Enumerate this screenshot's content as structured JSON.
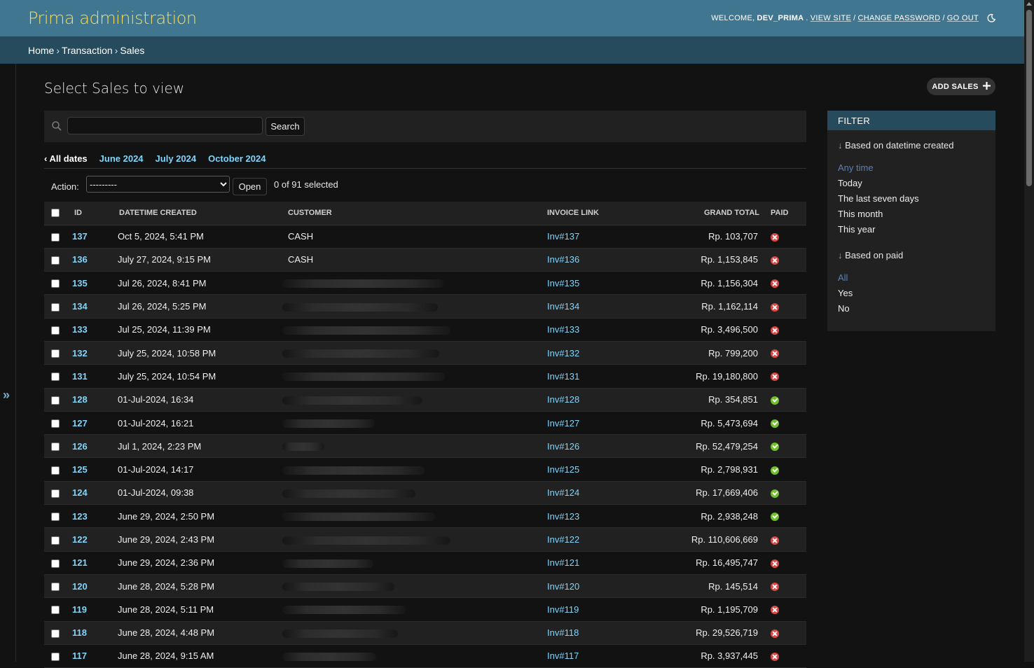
{
  "header": {
    "site_name": "Prima administration",
    "welcome_prefix": "Welcome,",
    "username": "dev_prima",
    "view_site": "View site",
    "change_password": "Change password",
    "log_out": "Go out"
  },
  "breadcrumbs": [
    "Home",
    "Transaction",
    "Sales"
  ],
  "page_title": "Select Sales to view",
  "add_button": "Add Sales",
  "search": {
    "button": "Search",
    "value": ""
  },
  "date_hierarchy": {
    "all": "All dates",
    "links": [
      "June 2024",
      "July 2024",
      "October 2024"
    ]
  },
  "actions": {
    "label": "Action:",
    "selected": "---------",
    "go": "Open",
    "counter": "0 of 91 selected"
  },
  "table": {
    "columns": [
      "ID",
      "Datetime created",
      "Customer",
      "Invoice link",
      "Grand total",
      "Paid"
    ],
    "rows": [
      {
        "id": "137",
        "dt": "Oct 5, 2024, 5:41 PM",
        "customer": "CASH",
        "invoice": "Inv#137",
        "total": "Rp. 103,707",
        "paid": false
      },
      {
        "id": "136",
        "dt": "July 27, 2024, 9:15 PM",
        "customer": "CASH",
        "invoice": "Inv#136",
        "total": "Rp. 1,153,845",
        "paid": false
      },
      {
        "id": "135",
        "dt": "Jul 26, 2024, 8:41 PM",
        "customer": "",
        "invoice": "Inv#135",
        "total": "Rp. 1,156,304",
        "paid": false
      },
      {
        "id": "134",
        "dt": "Jul 26, 2024, 5:25 PM",
        "customer": "",
        "invoice": "Inv#134",
        "total": "Rp. 1,162,114",
        "paid": false
      },
      {
        "id": "133",
        "dt": "Jul 25, 2024, 11:39 PM",
        "customer": "",
        "invoice": "Inv#133",
        "total": "Rp. 3,496,500",
        "paid": false
      },
      {
        "id": "132",
        "dt": "July 25, 2024, 10:58 PM",
        "customer": "",
        "invoice": "Inv#132",
        "total": "Rp. 799,200",
        "paid": false
      },
      {
        "id": "131",
        "dt": "July 25, 2024, 10:54 PM",
        "customer": "",
        "invoice": "Inv#131",
        "total": "Rp. 19,180,800",
        "paid": false
      },
      {
        "id": "128",
        "dt": "01-Jul-2024, 16:34",
        "customer": "",
        "invoice": "Inv#128",
        "total": "Rp. 354,851",
        "paid": true
      },
      {
        "id": "127",
        "dt": "01-Jul-2024, 16:21",
        "customer": "",
        "invoice": "Inv#127",
        "total": "Rp. 5,473,694",
        "paid": true
      },
      {
        "id": "126",
        "dt": "Jul 1, 2024, 2:23 PM",
        "customer": "",
        "invoice": "Inv#126",
        "total": "Rp. 52,479,254",
        "paid": true
      },
      {
        "id": "125",
        "dt": "01-Jul-2024, 14:17",
        "customer": "",
        "invoice": "Inv#125",
        "total": "Rp. 2,798,931",
        "paid": true
      },
      {
        "id": "124",
        "dt": "01-Jul-2024, 09:38",
        "customer": "",
        "invoice": "Inv#124",
        "total": "Rp. 17,669,406",
        "paid": true
      },
      {
        "id": "123",
        "dt": "June 29, 2024, 2:50 PM",
        "customer": "",
        "invoice": "Inv#123",
        "total": "Rp. 2,938,248",
        "paid": true
      },
      {
        "id": "122",
        "dt": "June 29, 2024, 2:43 PM",
        "customer": "",
        "invoice": "Inv#122",
        "total": "Rp. 110,606,669",
        "paid": false
      },
      {
        "id": "121",
        "dt": "June 29, 2024, 2:36 PM",
        "customer": "",
        "invoice": "Inv#121",
        "total": "Rp. 16,495,747",
        "paid": false
      },
      {
        "id": "120",
        "dt": "June 28, 2024, 5:28 PM",
        "customer": "",
        "invoice": "Inv#120",
        "total": "Rp. 145,514",
        "paid": false
      },
      {
        "id": "119",
        "dt": "June 28, 2024, 5:11 PM",
        "customer": "",
        "invoice": "Inv#119",
        "total": "Rp. 1,195,709",
        "paid": false
      },
      {
        "id": "118",
        "dt": "June 28, 2024, 4:48 PM",
        "customer": "",
        "invoice": "Inv#118",
        "total": "Rp. 29,526,719",
        "paid": false
      },
      {
        "id": "117",
        "dt": "June 28, 2024, 9:15 AM",
        "customer": "",
        "invoice": "Inv#117",
        "total": "Rp. 3,937,445",
        "paid": false
      }
    ]
  },
  "filter": {
    "title": "Filter",
    "groups": [
      {
        "title": "Based on datetime created",
        "options": [
          "Any time",
          "Today",
          "The last seven days",
          "This month",
          "This year"
        ],
        "selected": "Any time"
      },
      {
        "title": "Based on paid",
        "options": [
          "All",
          "Yes",
          "No"
        ],
        "selected": "All"
      }
    ]
  },
  "icons": {
    "search": "search-icon",
    "add": "plus-icon",
    "theme": "moon-icon",
    "nav_toggle": "double-chevron-right-icon",
    "paid_true": "check-circle-icon",
    "paid_false": "cross-circle-icon"
  },
  "colors": {
    "header": "#417690",
    "breadcrumbs": "#264b5d",
    "site_name": "#f5dd5d",
    "link": "#81d4fa",
    "paid_yes": "#70bf2b",
    "paid_no": "#dd4646"
  }
}
